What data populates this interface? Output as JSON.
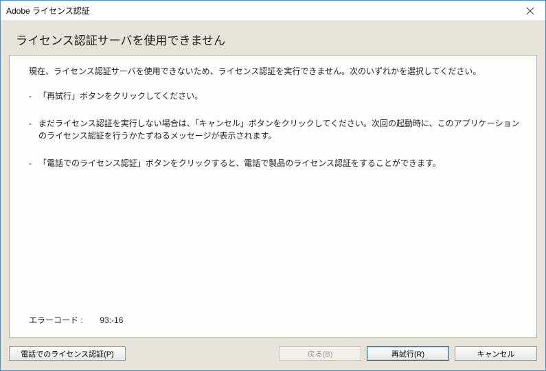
{
  "titlebar": {
    "title": "Adobe ライセンス認証"
  },
  "heading": "ライセンス認証サーバを使用できません",
  "intro": "現在、ライセンス認証サーバを使用できないため、ライセンス認証を実行できません。次のいずれかを選択してください。",
  "bullets": [
    "「再試行」ボタンをクリックしてください。",
    "まだライセンス認証を実行しない場合は、「キャンセル」ボタンをクリックしてください。次回の起動時に、このアプリケーションのライセンス認証を行うかたずねるメッセージが表示されます。",
    "「電話でのライセンス認証」ボタンをクリックすると、電話で製品のライセンス認証をすることができます。"
  ],
  "error": {
    "label": "エラーコード :",
    "code": "93:-16"
  },
  "buttons": {
    "phone": "電話でのライセンス認証(P)",
    "back": "戻る(B)",
    "retry": "再試行(R)",
    "cancel": "キャンセル"
  }
}
